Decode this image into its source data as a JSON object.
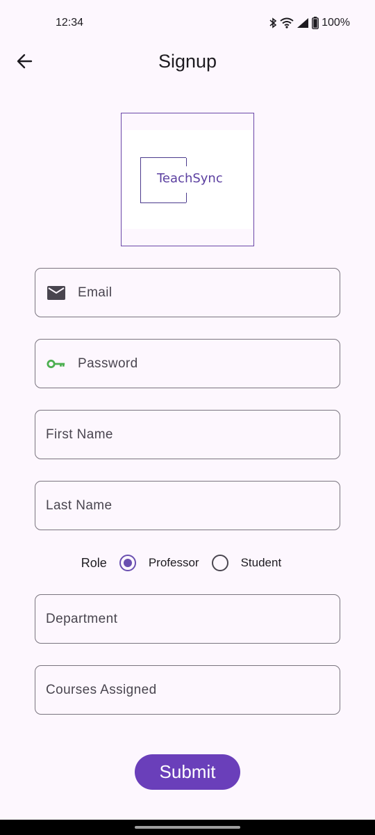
{
  "status_bar": {
    "time": "12:34",
    "battery": "100%",
    "icons": [
      "bluetooth-icon",
      "wifi-icon",
      "signal-icon",
      "battery-icon"
    ]
  },
  "app_bar": {
    "title": "Signup",
    "back_icon": "arrow-left-icon"
  },
  "logo": {
    "text": "TeachSync"
  },
  "form": {
    "email": {
      "label": "Email",
      "icon": "mail-icon"
    },
    "password": {
      "label": "Password",
      "icon": "key-icon"
    },
    "first_name": {
      "label": "First Name"
    },
    "last_name": {
      "label": "Last Name"
    },
    "role": {
      "label": "Role",
      "options": [
        "Professor",
        "Student"
      ],
      "selected": "Professor"
    },
    "department": {
      "label": "Department"
    },
    "courses": {
      "label": "Courses Assigned"
    }
  },
  "submit": {
    "label": "Submit"
  },
  "colors": {
    "background": "#fdf7fe",
    "primary": "#6a3fba",
    "key_icon": "#4caf50",
    "outline": "#79747e"
  }
}
